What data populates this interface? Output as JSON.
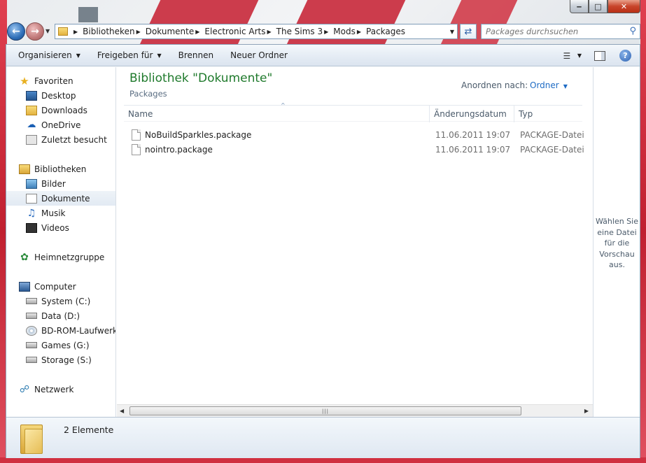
{
  "window": {
    "minimize_label": "‒",
    "maximize_label": "□",
    "close_label": "✕"
  },
  "address": {
    "crumbs": [
      "Bibliotheken",
      "Dokumente",
      "Electronic Arts",
      "The Sims 3",
      "Mods",
      "Packages"
    ]
  },
  "search": {
    "placeholder": "Packages durchsuchen"
  },
  "toolbar": {
    "organize": "Organisieren",
    "share": "Freigeben für",
    "burn": "Brennen",
    "new_folder": "Neuer Ordner",
    "help": "?"
  },
  "navpane": {
    "favorites": "Favoriten",
    "desktop": "Desktop",
    "downloads": "Downloads",
    "onedrive": "OneDrive",
    "recent": "Zuletzt besucht",
    "libraries": "Bibliotheken",
    "pictures": "Bilder",
    "documents": "Dokumente",
    "music": "Musik",
    "videos": "Videos",
    "homegroup": "Heimnetzgruppe",
    "computer": "Computer",
    "drive_c": "System (C:)",
    "drive_d": "Data (D:)",
    "drive_bd": "BD-ROM-Laufwerk (",
    "drive_g": "Games (G:)",
    "drive_s": "Storage (S:)",
    "network": "Netzwerk"
  },
  "content": {
    "title": "Bibliothek \"Dokumente\"",
    "subtitle": "Packages",
    "arrange_label": "Anordnen nach:",
    "arrange_value": "Ordner",
    "columns": {
      "name": "Name",
      "date": "Änderungsdatum",
      "type": "Typ"
    },
    "files": [
      {
        "name": "NoBuildSparkles.package",
        "date": "11.06.2011 19:07",
        "type": "PACKAGE-Datei"
      },
      {
        "name": "nointro.package",
        "date": "11.06.2011 19:07",
        "type": "PACKAGE-Datei"
      }
    ]
  },
  "preview": {
    "text": "Wählen Sie eine Datei für die Vorschau aus."
  },
  "details": {
    "count": "2 Elemente"
  },
  "colors": {
    "title_green": "#1f7a2c",
    "link_blue": "#1e6bc4"
  }
}
